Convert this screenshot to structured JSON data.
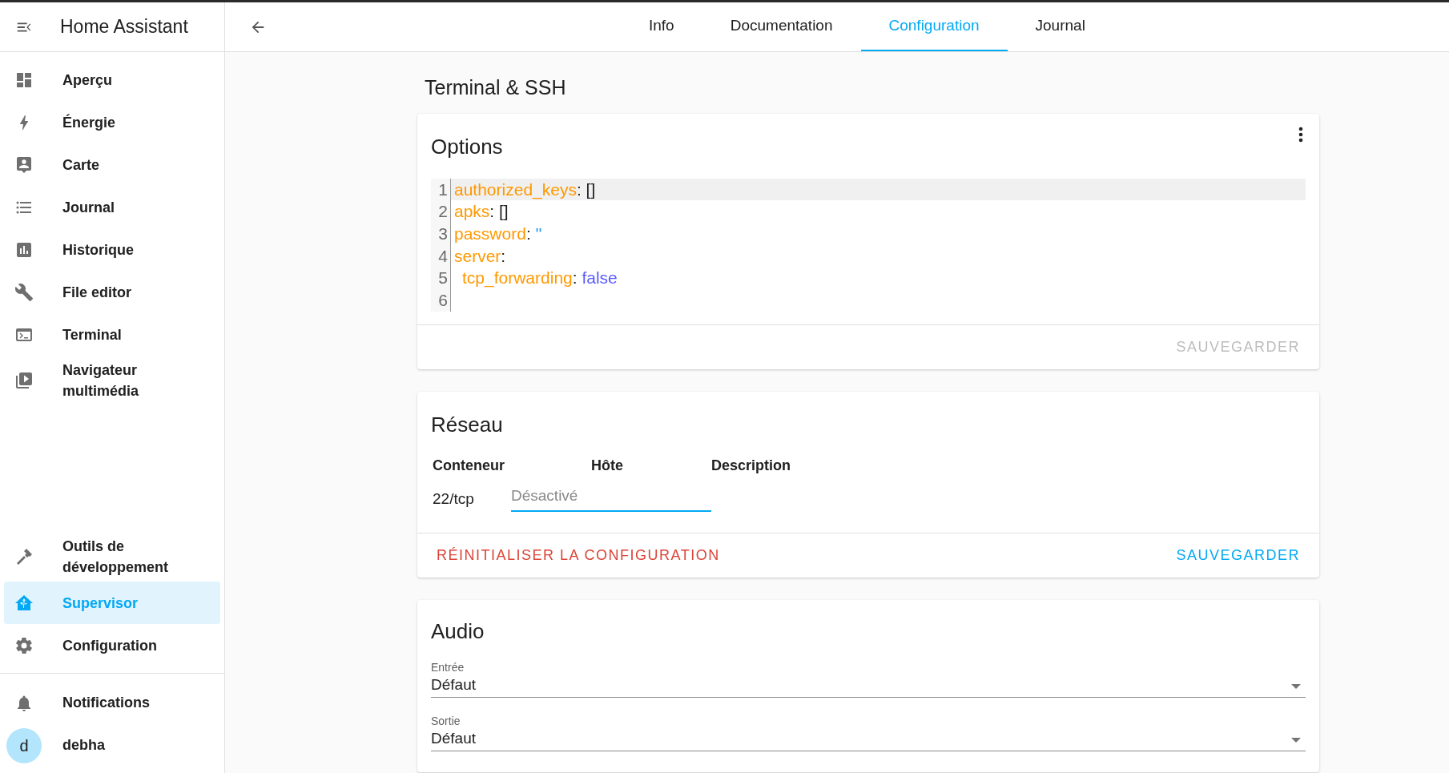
{
  "sidebar": {
    "title": "Home Assistant",
    "items": [
      {
        "label": "Aperçu",
        "selected": false
      },
      {
        "label": "Énergie",
        "selected": false
      },
      {
        "label": "Carte",
        "selected": false
      },
      {
        "label": "Journal",
        "selected": false
      },
      {
        "label": "Historique",
        "selected": false
      },
      {
        "label": "File editor",
        "selected": false
      },
      {
        "label": "Terminal",
        "selected": false
      },
      {
        "label": "Navigateur multimédia",
        "selected": false
      }
    ],
    "bottom_items": [
      {
        "label": "Outils de développement",
        "selected": false
      },
      {
        "label": "Supervisor",
        "selected": true
      },
      {
        "label": "Configuration",
        "selected": false
      }
    ],
    "notifications": "Notifications",
    "user": {
      "initial": "d",
      "name": "debha"
    }
  },
  "tabs": [
    {
      "label": "Info",
      "selected": false
    },
    {
      "label": "Documentation",
      "selected": false
    },
    {
      "label": "Configuration",
      "selected": true
    },
    {
      "label": "Journal",
      "selected": false
    }
  ],
  "page_title": "Terminal & SSH",
  "options": {
    "title": "Options",
    "lines": [
      {
        "number": "1",
        "active": true,
        "indented": false,
        "tokens": [
          {
            "text": "authorized_keys",
            "kind": "key"
          },
          {
            "text": ": ",
            "kind": "punct"
          },
          {
            "text": "[]",
            "kind": "punct"
          }
        ]
      },
      {
        "number": "2",
        "active": false,
        "indented": false,
        "tokens": [
          {
            "text": "apks",
            "kind": "key"
          },
          {
            "text": ": ",
            "kind": "punct"
          },
          {
            "text": "[]",
            "kind": "punct"
          }
        ]
      },
      {
        "number": "3",
        "active": false,
        "indented": false,
        "tokens": [
          {
            "text": "password",
            "kind": "key"
          },
          {
            "text": ": ",
            "kind": "punct"
          },
          {
            "text": "''",
            "kind": "string"
          }
        ]
      },
      {
        "number": "4",
        "active": false,
        "indented": false,
        "tokens": [
          {
            "text": "server",
            "kind": "key"
          },
          {
            "text": ":",
            "kind": "punct"
          }
        ]
      },
      {
        "number": "5",
        "active": false,
        "indented": true,
        "tokens": [
          {
            "text": "tcp_forwarding",
            "kind": "key"
          },
          {
            "text": ": ",
            "kind": "punct"
          },
          {
            "text": "false",
            "kind": "bool"
          }
        ]
      },
      {
        "number": "6"
      }
    ],
    "save": {
      "label": "SAUVEGARDER",
      "disabled": true
    }
  },
  "network": {
    "title": "Réseau",
    "columns": [
      "Conteneur",
      "Hôte",
      "Description"
    ],
    "rows": [
      {
        "container": "22/tcp",
        "host_placeholder": "Désactivé"
      }
    ],
    "reset": "RÉINITIALISER LA CONFIGURATION",
    "save": {
      "label": "SAUVEGARDER",
      "disabled": false
    }
  },
  "audio": {
    "title": "Audio",
    "fields": [
      {
        "label": "Entrée",
        "value": "Défaut"
      },
      {
        "label": "Sortie",
        "value": "Défaut"
      }
    ]
  }
}
